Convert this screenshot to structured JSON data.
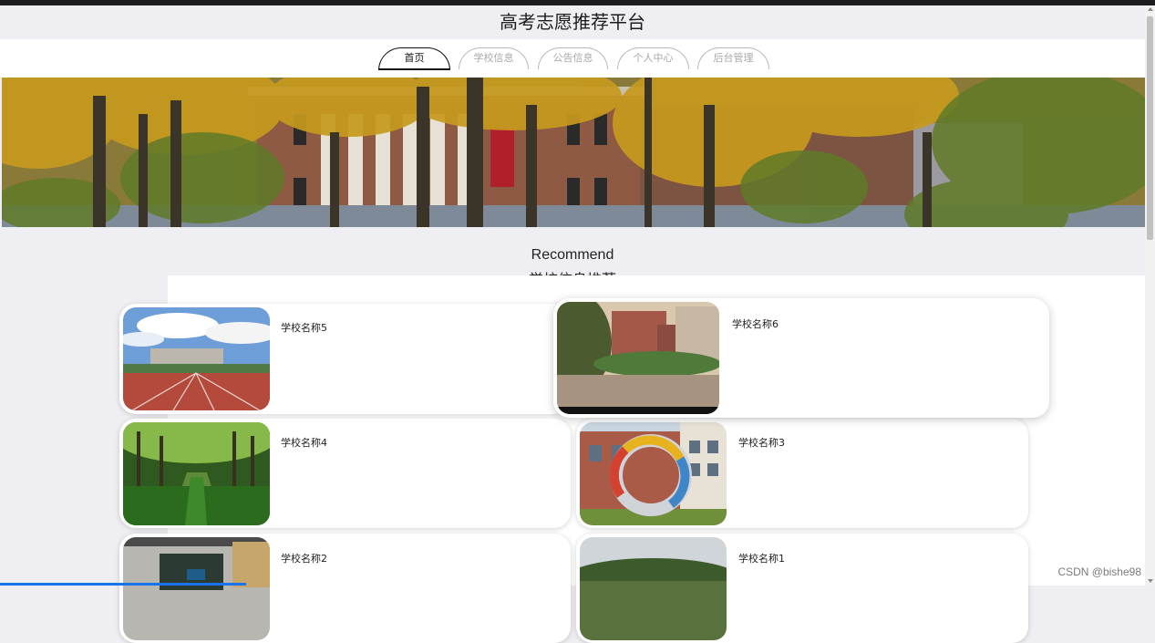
{
  "site": {
    "title": "高考志愿推荐平台"
  },
  "nav": {
    "tabs": [
      {
        "label": "首页",
        "active": true
      },
      {
        "label": "学校信息",
        "active": false
      },
      {
        "label": "公告信息",
        "active": false
      },
      {
        "label": "个人中心",
        "active": false
      },
      {
        "label": "后台管理",
        "active": false
      }
    ]
  },
  "section": {
    "title_en": "Recommend",
    "title_cn": "学校信息推荐"
  },
  "schools": [
    {
      "name": "学校名称5"
    },
    {
      "name": "学校名称6"
    },
    {
      "name": "学校名称4"
    },
    {
      "name": "学校名称3"
    },
    {
      "name": "学校名称2"
    },
    {
      "name": "学校名称1"
    }
  ],
  "footer": {
    "watermark": "CSDN @bishe98"
  },
  "colors": {
    "page_bg": "#efeff3",
    "accent": "#1a73e8"
  }
}
